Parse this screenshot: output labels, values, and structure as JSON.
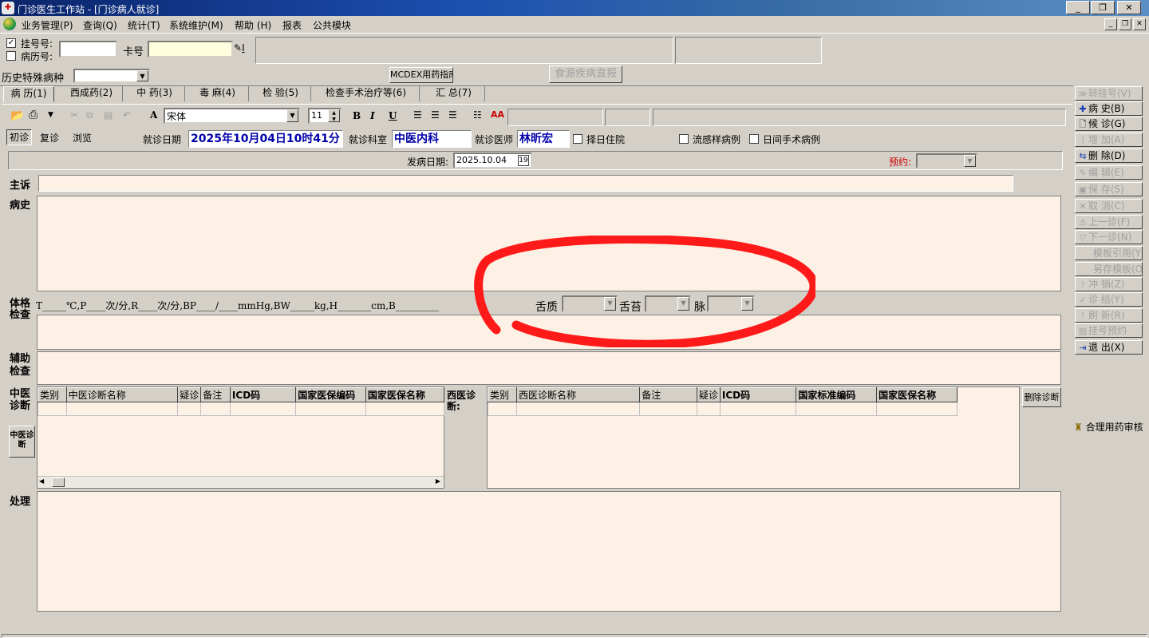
{
  "window": {
    "title": "门诊医生工作站 - [门诊病人就诊]",
    "app_icon": "app-logo-icon",
    "minimize": "_",
    "restore": "❐",
    "close": "✕"
  },
  "menu": {
    "items": [
      "业务管理(P)",
      "查询(Q)",
      "统计(T)",
      "系统维护(M)",
      "帮助 (H)",
      "报表",
      "公共模块"
    ],
    "mdi_minimize": "_",
    "mdi_restore": "❐",
    "mdi_close": "✕"
  },
  "patient_search": {
    "reg_no_label": "挂号号:",
    "record_no_label": "病历号:",
    "reg_no_checked": true,
    "record_no_checked": false,
    "card_label": "卡号",
    "reg_no_value": "",
    "card_value": "",
    "card_button_text": "I"
  },
  "history": {
    "label": "历史特殊病种",
    "value": "",
    "mcdex_button": "MCDEX用药指南",
    "food_button": "食源疾病直报"
  },
  "tabs": [
    "病 历(1)",
    "西成药(2)",
    "中 药(3)",
    "毒 麻(4)",
    "检 验(5)",
    "检查手术治疗等(6)",
    "汇 总(7)"
  ],
  "editor": {
    "font_name": "宋体",
    "font_size": "11",
    "bold": "B",
    "italic": "I",
    "underline": "U"
  },
  "visit": {
    "types": [
      "初诊",
      "复诊",
      "浏览"
    ],
    "date_label": "就诊日期",
    "date_value": "2025年10月04日10时41分",
    "dept_label": "就诊科室",
    "dept_value": "中医内科",
    "doctor_label": "就诊医师",
    "doctor_value": "林昕宏",
    "inpatient_label": "择日住院",
    "flu_label": "流感样病例",
    "day_surgery_label": "日间手术病例"
  },
  "onset": {
    "label": "发病日期:",
    "value": "2025.10.04",
    "appointment_label": "预约:"
  },
  "record": {
    "chief_complaint_label": "主诉",
    "history_label": "病史",
    "physical_label": "体格检查",
    "vitals_text": "T_____℃,P____次/分,R____次/分,BP____/____mmHg,BW_____kg,H_______cm,B_________",
    "tongue_quality_label": "舌质",
    "tongue_coating_label": "舌苔",
    "pulse_label": "脉",
    "aux_label": "辅助检查",
    "tcm_diag_label": "中医诊断",
    "tcm_button": "中医诊断",
    "western_diag_label": "西医诊断:",
    "delete_diag_button": "删除诊断",
    "treatment_label": "处理"
  },
  "tcm_grid": {
    "headers": [
      "类别",
      "中医诊断名称",
      "疑诊",
      "备注",
      "ICD码",
      "国家医保编码",
      "国家医保名称"
    ]
  },
  "western_grid": {
    "headers": [
      "类别",
      "西医诊断名称",
      "备注",
      "疑诊",
      "ICD码",
      "国家标准编码",
      "国家医保名称"
    ]
  },
  "side_buttons": [
    {
      "label": "转挂号(V)",
      "icon": "forward-icon",
      "glyph": "≫",
      "enabled": false
    },
    {
      "label": "病  史(B)",
      "icon": "plus-icon",
      "glyph": "✚",
      "enabled": true
    },
    {
      "label": "候  诊(G)",
      "icon": "document-icon",
      "glyph": "🗋",
      "enabled": true
    },
    {
      "label": "增  加(A)",
      "icon": "add-icon",
      "glyph": "┆",
      "enabled": false
    },
    {
      "label": "删  除(D)",
      "icon": "delete-icon",
      "glyph": "⇆",
      "enabled": true
    },
    {
      "label": "编  辑(E)",
      "icon": "edit-icon",
      "glyph": "✎",
      "enabled": false
    },
    {
      "label": "保  存(S)",
      "icon": "save-icon",
      "glyph": "▣",
      "enabled": false
    },
    {
      "label": "取  消(C)",
      "icon": "cancel-icon",
      "glyph": "✕",
      "enabled": false
    },
    {
      "label": "上一诊(F)",
      "icon": "up-icon",
      "glyph": "⚠",
      "enabled": false
    },
    {
      "label": "下一诊(N)",
      "icon": "down-icon",
      "glyph": "▽",
      "enabled": false
    },
    {
      "label": "模板引用(Y)",
      "icon": "",
      "glyph": "",
      "enabled": false
    },
    {
      "label": "另存模板(O)",
      "icon": "",
      "glyph": "",
      "enabled": false
    },
    {
      "label": "冲  销(Z)",
      "icon": "reverse-icon",
      "glyph": "!",
      "enabled": false
    },
    {
      "label": "诊  结(Y)",
      "icon": "check-icon",
      "glyph": "✓",
      "enabled": false
    },
    {
      "label": "刷  新(R)",
      "icon": "refresh-icon",
      "glyph": "!",
      "enabled": false
    },
    {
      "label": "挂号预约",
      "icon": "calendar-icon",
      "glyph": "▤",
      "enabled": false
    },
    {
      "label": "退  出(X)",
      "icon": "exit-icon",
      "glyph": "⇥",
      "enabled": true
    }
  ],
  "rational_drug_button": "合理用药审核",
  "colors": {
    "pink_bg": "#fdf0e4",
    "highlight_field": "#ffffe0",
    "blue_text": "#0000aa",
    "annotation_red": "#ff1a1a"
  }
}
